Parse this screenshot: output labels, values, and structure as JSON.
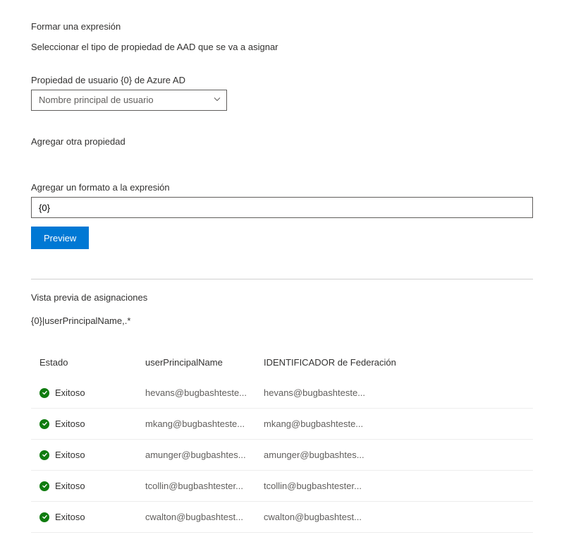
{
  "heading": "Formar una expresión",
  "subheading": "Seleccionar el tipo de propiedad de AAD que se va a asignar",
  "propertyLabel": "Propiedad de usuario {0} de Azure AD",
  "propertySelected": "Nombre principal de usuario",
  "addPropertyLink": "Agregar otra propiedad",
  "formatLabel": "Agregar un formato a la expresión",
  "formatValue": "{0}",
  "previewButton": "Preview",
  "previewHeading": "Vista previa de asignaciones",
  "expression": "{0}|userPrincipalName,.*",
  "columns": {
    "status": "Estado",
    "upn": "userPrincipalName",
    "federation": "IDENTIFICADOR de Federación"
  },
  "statusLabel": "Exitoso",
  "rows": [
    {
      "upn": "hevans@bugbashteste...",
      "federation": "hevans@bugbashteste..."
    },
    {
      "upn": "mkang@bugbashteste...",
      "federation": "mkang@bugbashteste..."
    },
    {
      "upn": "amunger@bugbashtes...",
      "federation": "amunger@bugbashtes..."
    },
    {
      "upn": "tcollin@bugbashtester...",
      "federation": "tcollin@bugbashtester..."
    },
    {
      "upn": "cwalton@bugbashtest...",
      "federation": "cwalton@bugbashtest..."
    }
  ],
  "colors": {
    "primary": "#0078d4",
    "success": "#107c10"
  }
}
